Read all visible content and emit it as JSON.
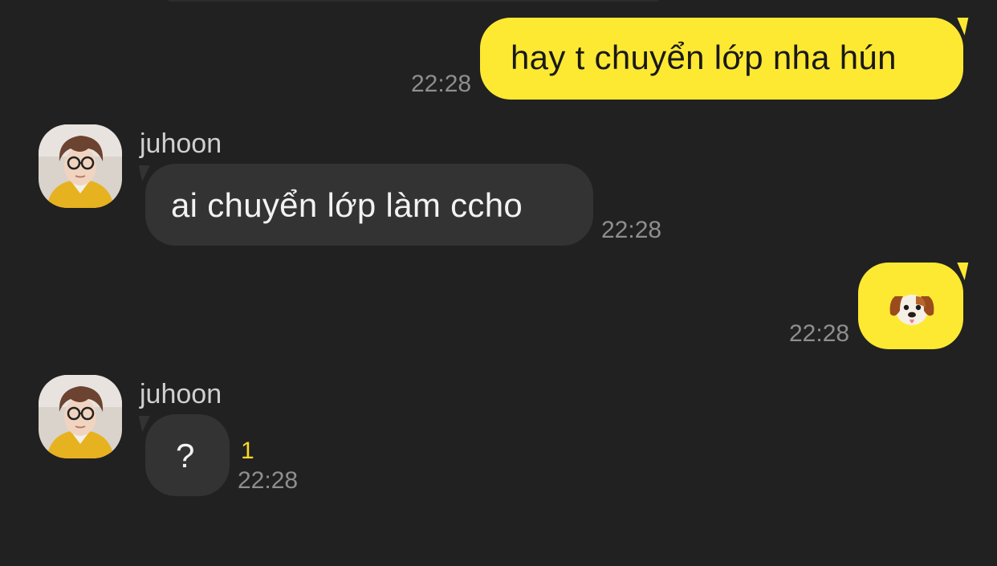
{
  "messages": [
    {
      "direction": "outgoing",
      "text": "hay t chuyển lớp nha hún",
      "time": "22:28"
    },
    {
      "direction": "incoming",
      "sender": "juhoon",
      "text": "ai chuyển lớp làm ccho",
      "time": "22:28"
    },
    {
      "direction": "outgoing",
      "emoji": "dog-face-emoji",
      "time": "22:28"
    },
    {
      "direction": "incoming",
      "sender": "juhoon",
      "text": "?",
      "unread": "1",
      "time": "22:28"
    }
  ],
  "colors": {
    "background": "#212121",
    "outgoing_bubble": "#fee932",
    "incoming_bubble": "#333333",
    "timestamp": "#8e8e8e",
    "unread_count": "#f7d82b"
  }
}
